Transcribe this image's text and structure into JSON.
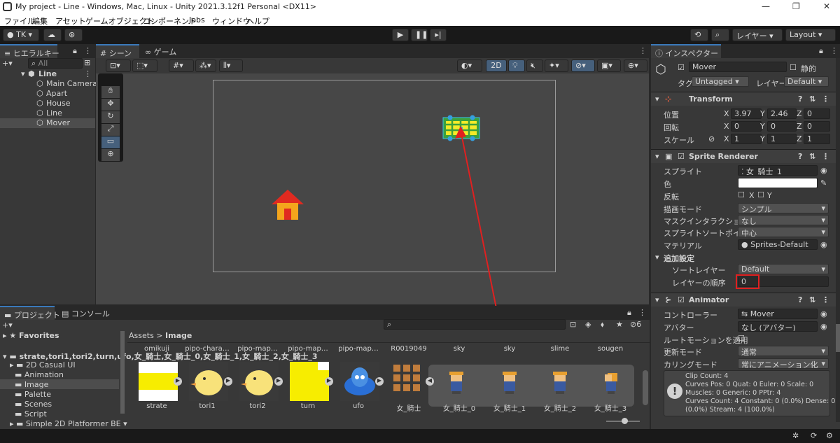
{
  "title": "My project - Line - Windows, Mac, Linux - Unity 2021.3.12f1 Personal <DX11>",
  "menu": [
    "ファイル",
    "編集",
    "アセット",
    "ゲームオブジェクト",
    "コンポーネント",
    "Jobs",
    "ウィンドウ",
    "ヘルプ"
  ],
  "toolbar": {
    "account": "TK",
    "layer_btn": "レイヤー",
    "layout_btn": "Layout"
  },
  "hierarchy": {
    "tab": "ヒエラルキー",
    "search_placeholder": "All",
    "scene": "Line",
    "items": [
      "Main Camera",
      "Apart",
      "House",
      "Line",
      "Mover"
    ]
  },
  "scene_tabs": {
    "scene": "シーン",
    "game": "ゲーム",
    "mode_2d": "2D"
  },
  "inspector": {
    "tab": "インスペクター",
    "object_name": "Mover",
    "static_label": "静的",
    "tag_label": "タグ",
    "tag": "Untagged",
    "layer_label": "レイヤー",
    "layer": "Default",
    "transform": {
      "title": "Transform",
      "pos_label": "位置",
      "rot_label": "回転",
      "scale_label": "スケール",
      "pos": {
        "x": "3.97",
        "y": "2.46",
        "z": "0"
      },
      "rot": {
        "x": "0",
        "y": "0",
        "z": "0"
      },
      "scale": {
        "x": "1",
        "y": "1",
        "z": "1"
      }
    },
    "sprite_renderer": {
      "title": "Sprite Renderer",
      "sprite_label": "スプライト",
      "sprite": "女_騎士_1",
      "color_label": "色",
      "flip_label": "反転",
      "flip_x": "X",
      "flip_y": "Y",
      "draw_mode_label": "描画モード",
      "draw_mode": "シンプル",
      "mask_label": "マスクインタラクション",
      "mask": "なし",
      "pivot_label": "スプライトソートポイント",
      "pivot": "中心",
      "material_label": "マテリアル",
      "material": "Sprites-Default",
      "additional_label": "追加設定",
      "sort_layer_label": "ソートレイヤー",
      "sort_layer": "Default",
      "order_label": "レイヤーの順序",
      "order": "0"
    },
    "animator": {
      "title": "Animator",
      "controller_label": "コントローラー",
      "controller": "Mover",
      "avatar_label": "アバター",
      "avatar": "なし (アバター)",
      "root_motion_label": "ルートモーションを適用",
      "update_label": "更新モード",
      "update": "通常",
      "culling_label": "カリングモード",
      "culling": "常にアニメーション化",
      "info": [
        "Clip Count: 4",
        "Curves Pos: 0 Quat: 0 Euler: 0 Scale: 0",
        "Muscles: 0 Generic: 0 PPtr: 4",
        "Curves Count: 4 Constant: 0 (0.0%) Dense: 0",
        "(0.0%) Stream: 4 (100.0%)"
      ]
    }
  },
  "project": {
    "tab": "プロジェクト",
    "console_tab": "コンソール",
    "favorites": "Favorites",
    "assets": [
      "strate",
      "tori1",
      "tori2",
      "turn",
      "ufo",
      "女_騎士",
      "女_騎士_0",
      "女_騎士_1",
      "女_騎士_2",
      "女_騎士_3"
    ],
    "folders": [
      "2D Casual UI",
      "Animation",
      "Image",
      "Palette",
      "Scenes",
      "Script",
      "Simple 2D Platformer BE"
    ],
    "breadcrumb_root": "Assets",
    "breadcrumb_current": "Image",
    "hidden_count": "6",
    "top_labels": [
      "omikuji",
      "pipo-chara…",
      "pipo-map…",
      "pipo-map…",
      "pipo-map…",
      "R0019049",
      "sky",
      "sky",
      "slime",
      "sougen"
    ]
  },
  "colors": {
    "accent": "#3a79bb",
    "highlight_red": "#e02020",
    "selection": "#2c5d87"
  }
}
